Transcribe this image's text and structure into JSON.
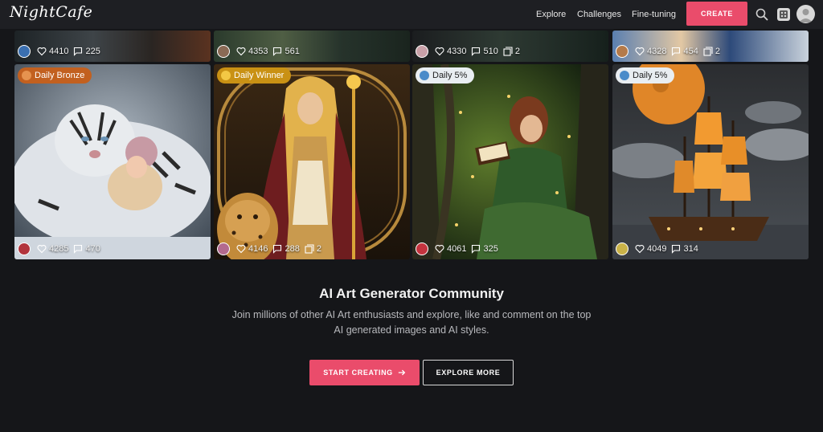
{
  "header": {
    "logo": "NightCafe",
    "nav": [
      "Explore",
      "Challenges",
      "Fine-tuning"
    ],
    "create_label": "CREATE",
    "icons": [
      "search-icon",
      "dice-icon",
      "user-avatar"
    ]
  },
  "top_row": [
    {
      "likes": "4410",
      "comments": "225",
      "images": ""
    },
    {
      "likes": "4353",
      "comments": "561",
      "images": ""
    },
    {
      "likes": "4330",
      "comments": "510",
      "images": "2"
    },
    {
      "likes": "4328",
      "comments": "454",
      "images": "2"
    }
  ],
  "cards": [
    {
      "badge": "Daily Bronze",
      "badge_color": "#c2601f",
      "likes": "4285",
      "comments": "470",
      "images": ""
    },
    {
      "badge": "Daily Winner",
      "badge_color": "#c99114",
      "likes": "4146",
      "comments": "288",
      "images": "2"
    },
    {
      "badge": "Daily 5%",
      "badge_color": "#e9eef2",
      "likes": "4061",
      "comments": "325",
      "images": ""
    },
    {
      "badge": "Daily 5%",
      "badge_color": "#e9eef2",
      "likes": "4049",
      "comments": "314",
      "images": ""
    }
  ],
  "community": {
    "title": "AI Art Generator Community",
    "description": "Join millions of other AI Art enthusiasts and explore, like and comment on the top AI generated images and AI styles.",
    "start_label": "START CREATING",
    "explore_label": "EXPLORE MORE"
  },
  "colors": {
    "accent": "#ea4c6b",
    "background": "#151619",
    "header": "#1e1f23"
  }
}
